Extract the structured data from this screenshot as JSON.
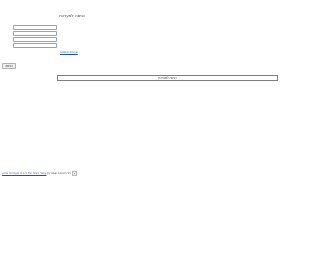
{
  "login": {
    "title": "כניסה למערכת",
    "forgot_password_link": "שכחתי סיסמה",
    "small_button_label": "כניסה"
  },
  "main": {
    "wide_button_label": "כניסה למערכת"
  },
  "footer": {
    "link_text": "עמוד הבית של ב.ג.ה מערכות מידע",
    "suffix_text": "כל הזכויות שמורות"
  }
}
